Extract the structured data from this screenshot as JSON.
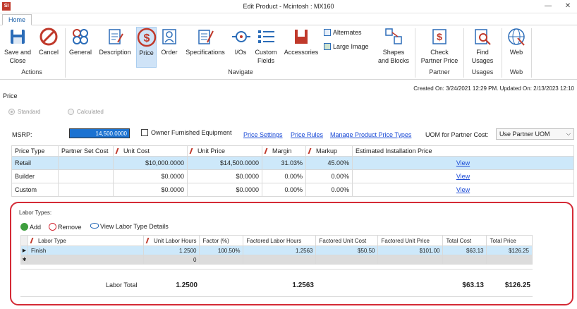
{
  "window": {
    "title": "Edit Product - Mcintosh : MX160",
    "app_icon": "SI"
  },
  "tabs": [
    "Home"
  ],
  "ribbon": {
    "save_close": "Save and\nClose",
    "cancel": "Cancel",
    "actions_group": "Actions",
    "general": "General",
    "description": "Description",
    "price": "Price",
    "order": "Order",
    "specifications": "Specifications",
    "ios": "I/Os",
    "custom_fields": "Custom\nFields",
    "accessories": "Accessories",
    "alternates": "Alternates",
    "large_image": "Large Image",
    "navigate_group": "Navigate",
    "shapes_blocks": "Shapes\nand Blocks",
    "check_partner_price": "Check\nPartner Price",
    "partner_group": "Partner",
    "find_usages": "Find\nUsages",
    "usages_group": "Usages",
    "web": "Web",
    "web_group": "Web"
  },
  "meta": {
    "created": "Created On: 3/24/2021 12:29 PM. Updated On: 2/13/2023 12:10"
  },
  "price_section": {
    "label": "Price",
    "radio_standard": "Standard",
    "radio_calculated": "Calculated",
    "msrp_label": "MSRP:",
    "msrp_value": "14,500.0000",
    "owner_furnished": "Owner Furnished Equipment",
    "price_settings": "Price Settings",
    "price_rules": "Price Rules",
    "manage_product_price_types": "Manage Product Price Types",
    "uom_label": "UOM for Partner Cost:",
    "uom_value": "Use Partner UOM"
  },
  "price_table": {
    "headers": [
      "Price Type",
      "Partner Set Cost",
      "Unit Cost",
      "Unit Price",
      "Margin",
      "Markup",
      "Estimated Installation Price"
    ],
    "rows": [
      {
        "type": "Retail",
        "partner_set_cost": "",
        "unit_cost": "$10,000.0000",
        "unit_price": "$14,500.0000",
        "margin": "31.03%",
        "markup": "45.00%",
        "link": "View"
      },
      {
        "type": "Builder",
        "partner_set_cost": "",
        "unit_cost": "$0.0000",
        "unit_price": "$0.0000",
        "margin": "0.00%",
        "markup": "0.00%",
        "link": "View"
      },
      {
        "type": "Custom",
        "partner_set_cost": "",
        "unit_cost": "$0.0000",
        "unit_price": "$0.0000",
        "margin": "0.00%",
        "markup": "0.00%",
        "link": "View"
      }
    ]
  },
  "labor": {
    "title": "Labor Types:",
    "add": "Add",
    "remove": "Remove",
    "view_details": "View Labor Type Details",
    "headers": [
      "Labor Type",
      "Unit Labor Hours",
      "Factor (%)",
      "Factored Labor Hours",
      "Factored Unit Cost",
      "Factored Unit Price",
      "Total Cost",
      "Total Price"
    ],
    "rows": [
      {
        "labor_type": "Finish",
        "unit_labor_hours": "1.2500",
        "factor": "100.50%",
        "factored_labor_hours": "1.2563",
        "factored_unit_cost": "$50.50",
        "factored_unit_price": "$101.00",
        "total_cost": "$63.13",
        "total_price": "$126.25"
      }
    ],
    "new_row_hours": "0",
    "total_label": "Labor Total",
    "total_unit_hours": "1.2500",
    "total_factored_hours": "1.2563",
    "total_cost": "$63.13",
    "total_price": "$126.25"
  }
}
